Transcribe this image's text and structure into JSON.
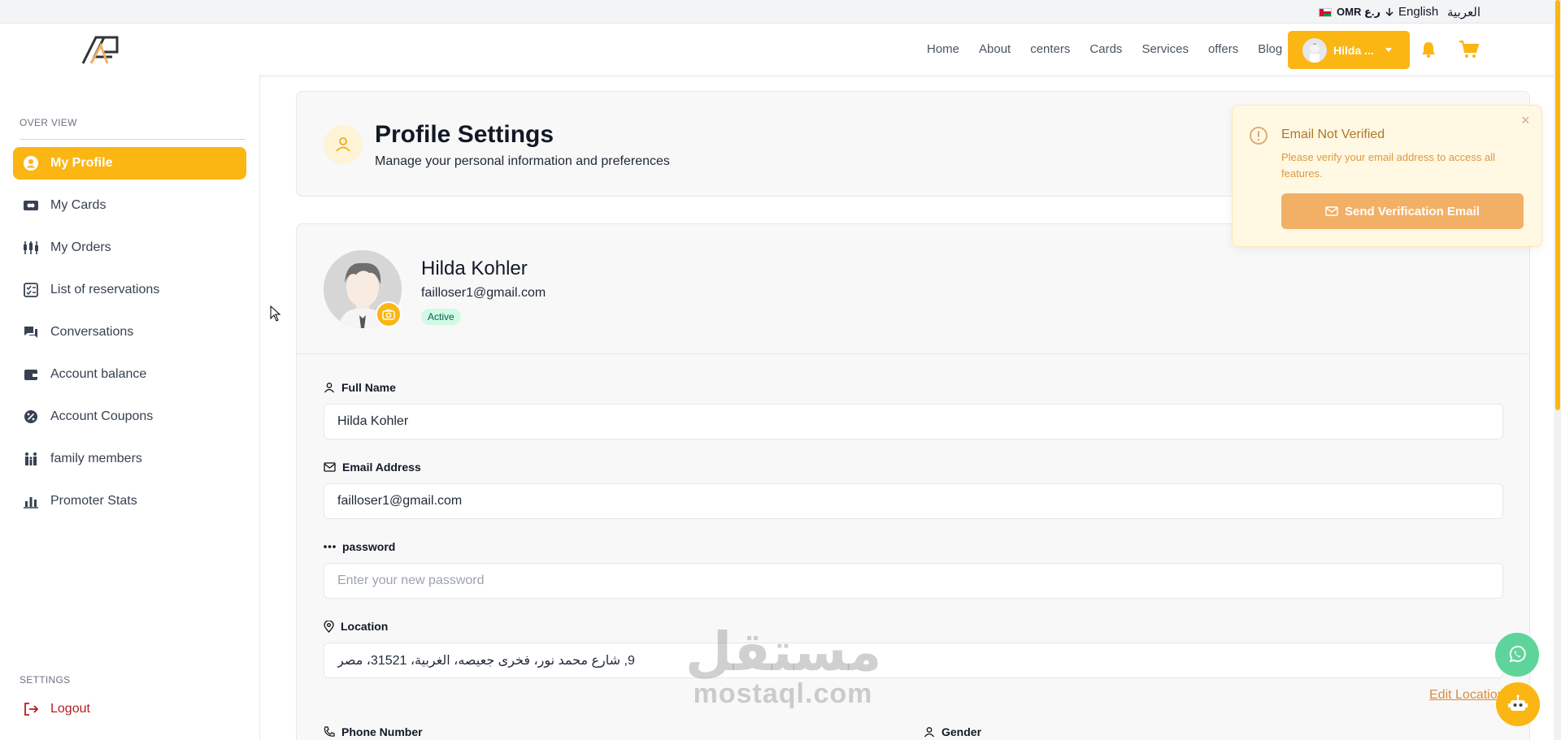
{
  "topbar": {
    "currency": "OMR ر.ع",
    "lang_en": "English",
    "lang_ar": "العربية"
  },
  "header": {
    "nav": [
      "Home",
      "About",
      "centers",
      "Cards",
      "Services",
      "offers",
      "Blog"
    ],
    "user_label": "Hilda ...",
    "accent_color": "#fbb614"
  },
  "sidebar": {
    "overview_title": "OVER VIEW",
    "items": [
      {
        "label": "My Profile",
        "icon": "user-circle-icon"
      },
      {
        "label": "My Cards",
        "icon": "card-icon"
      },
      {
        "label": "My Orders",
        "icon": "orders-icon"
      },
      {
        "label": "List of reservations",
        "icon": "checklist-icon"
      },
      {
        "label": "Conversations",
        "icon": "chat-icon"
      },
      {
        "label": "Account balance",
        "icon": "wallet-icon"
      },
      {
        "label": "Account Coupons",
        "icon": "coupon-icon"
      },
      {
        "label": "family members",
        "icon": "family-icon"
      },
      {
        "label": "Promoter Stats",
        "icon": "stats-icon"
      }
    ],
    "settings_title": "SETTINGS",
    "logout_label": "Logout"
  },
  "page_header": {
    "title": "Profile Settings",
    "subtitle": "Manage your personal information and preferences"
  },
  "profile": {
    "name": "Hilda Kohler",
    "email": "failloser1@gmail.com",
    "status": "Active"
  },
  "form": {
    "full_name_label": "Full Name",
    "full_name_value": "Hilda Kohler",
    "email_label": "Email Address",
    "email_value": "failloser1@gmail.com",
    "password_label": "password",
    "password_placeholder": "Enter your new password",
    "location_label": "Location",
    "location_value": "9, شارع محمد نور، فخرى جعيصه، الغربية، 31521، مصر",
    "edit_location": "Edit Location",
    "phone_label": "Phone Number",
    "gender_label": "Gender"
  },
  "toast": {
    "title": "Email Not Verified",
    "message": "Please verify your email address to access all features.",
    "button": "Send Verification Email",
    "close": "×"
  },
  "watermark": {
    "ar": "مستقل",
    "en": "mostaql.com"
  }
}
